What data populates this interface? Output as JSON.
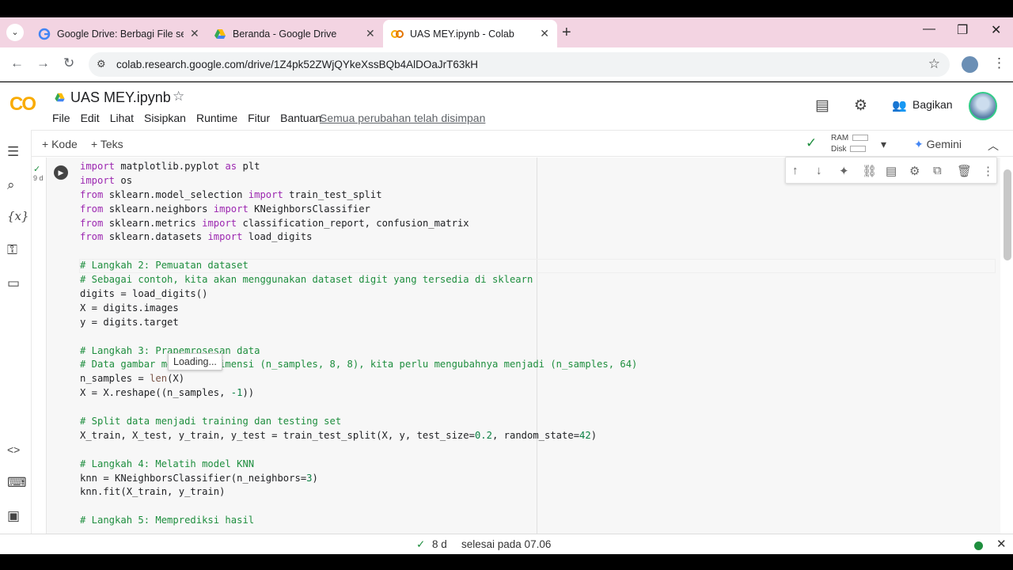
{
  "browser": {
    "tabs": [
      {
        "title": "Google Drive: Berbagi File secara",
        "icon": "google-g-icon"
      },
      {
        "title": "Beranda - Google Drive",
        "icon": "drive-icon"
      },
      {
        "title": "UAS MEY.ipynb - Colab",
        "icon": "colab-icon"
      }
    ],
    "url": "colab.research.google.com/drive/1Z4pk52ZWjQYkeXssBQb4AlDOaJrT63kH"
  },
  "colab": {
    "logo": "CO",
    "notebook_title": "UAS MEY.ipynb",
    "menu": [
      "File",
      "Edit",
      "Lihat",
      "Sisipkan",
      "Runtime",
      "Fitur",
      "Bantuan"
    ],
    "save_status": "Semua perubahan telah disimpan",
    "share_label": "Bagikan",
    "add_code": "Kode",
    "add_text": "Teks",
    "ram_label": "RAM",
    "disk_label": "Disk",
    "gemini_label": "Gemini"
  },
  "cell": {
    "exec_duration": "9 d",
    "tooltip": "Loading...",
    "lines": [
      [
        [
          "kw",
          "import"
        ],
        [
          "p",
          " matplotlib.pyplot "
        ],
        [
          "kw",
          "as"
        ],
        [
          "p",
          " plt"
        ]
      ],
      [
        [
          "kw",
          "import"
        ],
        [
          "p",
          " os"
        ]
      ],
      [
        [
          "kw",
          "from"
        ],
        [
          "p",
          " sklearn.model_selection "
        ],
        [
          "kw",
          "import"
        ],
        [
          "p",
          " train_test_split"
        ]
      ],
      [
        [
          "kw",
          "from"
        ],
        [
          "p",
          " sklearn.neighbors "
        ],
        [
          "kw",
          "import"
        ],
        [
          "p",
          " KNeighborsClassifier"
        ]
      ],
      [
        [
          "kw",
          "from"
        ],
        [
          "p",
          " sklearn.metrics "
        ],
        [
          "kw",
          "import"
        ],
        [
          "p",
          " classification_report, confusion_matrix"
        ]
      ],
      [
        [
          "kw",
          "from"
        ],
        [
          "p",
          " sklearn.datasets "
        ],
        [
          "kw",
          "import"
        ],
        [
          "p",
          " load_digits"
        ]
      ],
      [],
      [
        [
          "cm",
          "# Langkah 2: Pemuatan dataset"
        ]
      ],
      [
        [
          "cm",
          "# Sebagai contoh, kita akan menggunakan dataset digit yang tersedia di sklearn"
        ]
      ],
      [
        [
          "p",
          "digits = load_digits()"
        ]
      ],
      [
        [
          "p",
          "X = digits.images"
        ]
      ],
      [
        [
          "p",
          "y = digits.target"
        ]
      ],
      [],
      [
        [
          "cm",
          "# Langkah 3: Prapemrosesan data"
        ]
      ],
      [
        [
          "cm",
          "# Data gambar memiliki dimensi (n_samples, 8, 8), kita perlu mengubahnya menjadi (n_samples, 64)"
        ]
      ],
      [
        [
          "p",
          "n_samples = "
        ],
        [
          "fn",
          "len"
        ],
        [
          "p",
          "(X)"
        ]
      ],
      [
        [
          "p",
          "X = X.reshape((n_samples, "
        ],
        [
          "num",
          "-1"
        ],
        [
          "p",
          "))"
        ]
      ],
      [],
      [
        [
          "cm",
          "# Split data menjadi training dan testing set"
        ]
      ],
      [
        [
          "p",
          "X_train, X_test, y_train, y_test = train_test_split(X, y, test_size="
        ],
        [
          "num",
          "0.2"
        ],
        [
          "p",
          ", random_state="
        ],
        [
          "num",
          "42"
        ],
        [
          "p",
          ")"
        ]
      ],
      [],
      [
        [
          "cm",
          "# Langkah 4: Melatih model KNN"
        ]
      ],
      [
        [
          "p",
          "knn = KNeighborsClassifier(n_neighbors="
        ],
        [
          "num",
          "3"
        ],
        [
          "p",
          ")"
        ]
      ],
      [
        [
          "p",
          "knn.fit(X_train, y_train)"
        ]
      ],
      [],
      [
        [
          "cm",
          "# Langkah 5: Memprediksi hasil"
        ]
      ]
    ]
  },
  "statusbar": {
    "duration": "8 d",
    "text": "selesai pada 07.06"
  }
}
